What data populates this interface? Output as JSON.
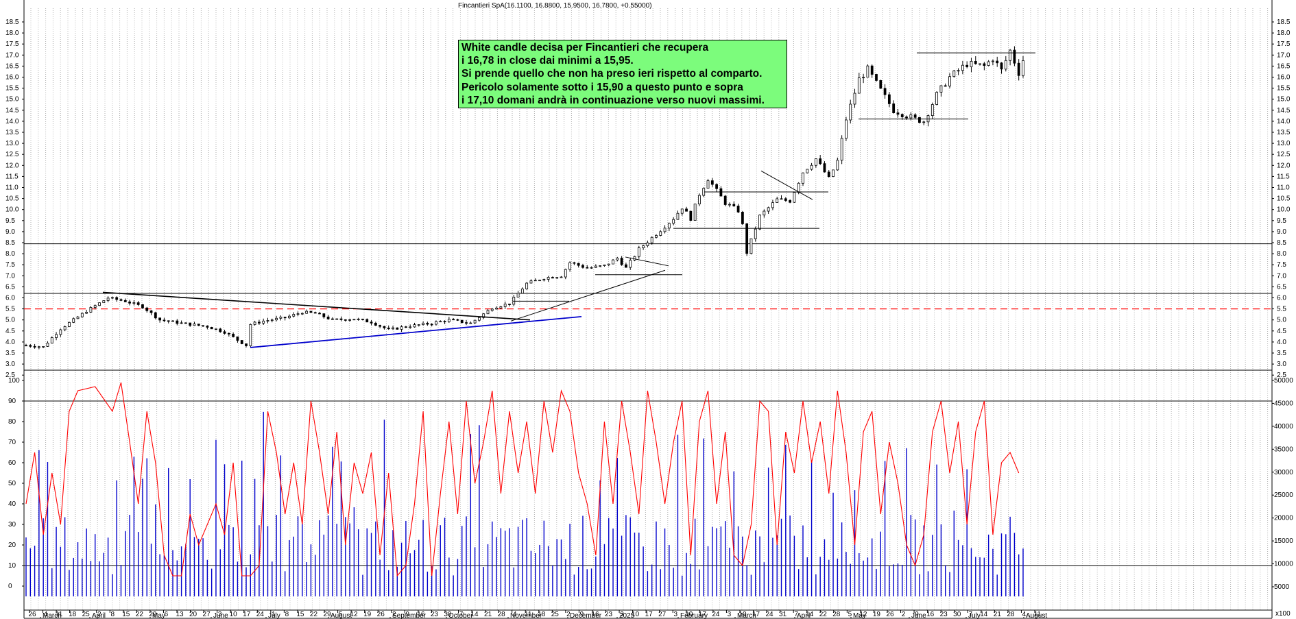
{
  "title": "Fincantieri SpA(16.1100, 16.8800, 15.9500, 16.7800, +0.55000)",
  "annotation": {
    "lines": [
      "White candle decisa per Fincantieri che recupera",
      "i 16,78 in close dai minimi a 15,95.",
      "Si prende quello che non ha preso ieri rispetto al comparto.",
      "Pericolo solamente sotto i 15,90 a questo punto e sopra",
      "i 17,10 domani andrà in continuazione verso nuovi massimi."
    ],
    "background": "#7CFC7C"
  },
  "chart_data": [
    {
      "type": "candlestick",
      "title": "Fincantieri SpA(16.1100, 16.8800, 15.9500, 16.7800, +0.55000)",
      "ylim": [
        2.0,
        18.5
      ],
      "y_ticks": [
        "2.5",
        "3.0",
        "3.5",
        "4.0",
        "4.5",
        "5.0",
        "5.5",
        "6.0",
        "6.5",
        "7.0",
        "7.5",
        "8.0",
        "8.5",
        "9.0",
        "9.5",
        "10.0",
        "10.5",
        "11.0",
        "11.5",
        "12.0",
        "12.5",
        "13.0",
        "13.5",
        "14.0",
        "14.5",
        "15.0",
        "15.5",
        "16.0",
        "16.5",
        "17.0",
        "17.5",
        "18.0",
        "18.5"
      ],
      "last": {
        "open": 16.11,
        "high": 16.88,
        "low": 15.95,
        "close": 16.78,
        "change": 0.55
      },
      "path_points": [
        [
          0,
          3.85
        ],
        [
          4,
          3.78
        ],
        [
          8,
          4.6
        ],
        [
          14,
          5.4
        ],
        [
          19,
          6.0
        ],
        [
          23,
          5.85
        ],
        [
          27,
          5.6
        ],
        [
          31,
          5.0
        ],
        [
          36,
          4.85
        ],
        [
          42,
          4.7
        ],
        [
          46,
          4.45
        ],
        [
          51,
          3.85
        ],
        [
          52,
          4.8
        ],
        [
          55,
          4.95
        ],
        [
          60,
          5.1
        ],
        [
          64,
          5.35
        ],
        [
          67,
          5.3
        ],
        [
          71,
          5.0
        ],
        [
          76,
          5.05
        ],
        [
          80,
          4.9
        ],
        [
          84,
          4.55
        ],
        [
          88,
          4.7
        ],
        [
          94,
          4.85
        ],
        [
          98,
          5.0
        ],
        [
          103,
          4.85
        ],
        [
          108,
          5.55
        ],
        [
          112,
          5.75
        ],
        [
          116,
          6.65
        ],
        [
          120,
          6.9
        ],
        [
          124,
          7.0
        ],
        [
          126,
          7.6
        ],
        [
          130,
          7.35
        ],
        [
          134,
          7.45
        ],
        [
          137,
          7.8
        ],
        [
          139,
          7.35
        ],
        [
          142,
          8.2
        ],
        [
          146,
          8.9
        ],
        [
          150,
          9.6
        ],
        [
          152,
          10.1
        ],
        [
          154,
          9.6
        ],
        [
          156,
          10.7
        ],
        [
          158,
          11.4
        ],
        [
          162,
          10.3
        ],
        [
          165,
          9.95
        ],
        [
          166,
          9.3
        ],
        [
          167,
          8.05
        ],
        [
          170,
          9.7
        ],
        [
          174,
          10.45
        ],
        [
          177,
          10.4
        ],
        [
          180,
          11.7
        ],
        [
          183,
          12.3
        ],
        [
          186,
          11.4
        ],
        [
          188,
          12.2
        ],
        [
          190,
          14.1
        ],
        [
          193,
          15.9
        ],
        [
          195,
          16.35
        ],
        [
          198,
          15.4
        ],
        [
          201,
          14.5
        ],
        [
          206,
          14.1
        ],
        [
          208,
          14.0
        ],
        [
          211,
          15.2
        ],
        [
          214,
          16.0
        ],
        [
          218,
          16.6
        ],
        [
          222,
          16.5
        ],
        [
          224,
          16.85
        ],
        [
          226,
          16.3
        ],
        [
          228,
          17.2
        ],
        [
          230,
          16.2
        ],
        [
          231,
          16.78
        ]
      ],
      "horizontal_levels": [
        8.45,
        6.2,
        5.5
      ]
    },
    {
      "type": "line+bar",
      "ylim": [
        -5,
        105
      ],
      "y_ticks": [
        "100",
        "90",
        "80",
        "70",
        "60",
        "50",
        "40",
        "30",
        "20",
        "10",
        "0"
      ],
      "levels": [
        90,
        10
      ],
      "volume_ticks": [
        "50000",
        "45000",
        "40000",
        "35000",
        "30000",
        "25000",
        "20000",
        "15000",
        "10000",
        "5000"
      ],
      "volume_unit": "x100",
      "oscillator_color": "#ff0000",
      "volume_color": "#0000cc",
      "oscillator_points": [
        [
          0,
          40
        ],
        [
          2,
          65
        ],
        [
          4,
          25
        ],
        [
          6,
          55
        ],
        [
          8,
          30
        ],
        [
          10,
          85
        ],
        [
          12,
          95
        ],
        [
          16,
          97
        ],
        [
          20,
          85
        ],
        [
          22,
          99
        ],
        [
          24,
          70
        ],
        [
          26,
          40
        ],
        [
          28,
          85
        ],
        [
          30,
          60
        ],
        [
          32,
          15
        ],
        [
          34,
          5
        ],
        [
          36,
          5
        ],
        [
          38,
          35
        ],
        [
          40,
          20
        ],
        [
          44,
          40
        ],
        [
          46,
          25
        ],
        [
          48,
          60
        ],
        [
          50,
          5
        ],
        [
          52,
          5
        ],
        [
          54,
          10
        ],
        [
          56,
          85
        ],
        [
          58,
          65
        ],
        [
          60,
          35
        ],
        [
          62,
          60
        ],
        [
          64,
          30
        ],
        [
          66,
          90
        ],
        [
          68,
          65
        ],
        [
          70,
          35
        ],
        [
          72,
          75
        ],
        [
          74,
          20
        ],
        [
          76,
          60
        ],
        [
          78,
          45
        ],
        [
          80,
          65
        ],
        [
          82,
          15
        ],
        [
          84,
          55
        ],
        [
          86,
          5
        ],
        [
          88,
          10
        ],
        [
          90,
          40
        ],
        [
          92,
          85
        ],
        [
          94,
          5
        ],
        [
          96,
          45
        ],
        [
          98,
          80
        ],
        [
          100,
          35
        ],
        [
          102,
          90
        ],
        [
          104,
          50
        ],
        [
          106,
          70
        ],
        [
          108,
          95
        ],
        [
          110,
          45
        ],
        [
          112,
          85
        ],
        [
          114,
          55
        ],
        [
          116,
          80
        ],
        [
          118,
          45
        ],
        [
          120,
          90
        ],
        [
          122,
          65
        ],
        [
          124,
          95
        ],
        [
          126,
          85
        ],
        [
          128,
          55
        ],
        [
          130,
          40
        ],
        [
          132,
          15
        ],
        [
          134,
          80
        ],
        [
          136,
          40
        ],
        [
          138,
          90
        ],
        [
          140,
          65
        ],
        [
          142,
          35
        ],
        [
          144,
          95
        ],
        [
          146,
          70
        ],
        [
          148,
          40
        ],
        [
          150,
          70
        ],
        [
          152,
          90
        ],
        [
          154,
          15
        ],
        [
          156,
          80
        ],
        [
          158,
          95
        ],
        [
          160,
          40
        ],
        [
          162,
          75
        ],
        [
          164,
          15
        ],
        [
          166,
          10
        ],
        [
          168,
          30
        ],
        [
          170,
          90
        ],
        [
          172,
          85
        ],
        [
          174,
          20
        ],
        [
          176,
          75
        ],
        [
          178,
          55
        ],
        [
          180,
          90
        ],
        [
          182,
          60
        ],
        [
          184,
          80
        ],
        [
          186,
          45
        ],
        [
          188,
          95
        ],
        [
          190,
          65
        ],
        [
          192,
          20
        ],
        [
          194,
          75
        ],
        [
          196,
          85
        ],
        [
          198,
          35
        ],
        [
          200,
          70
        ],
        [
          202,
          50
        ],
        [
          204,
          20
        ],
        [
          206,
          10
        ],
        [
          208,
          25
        ],
        [
          210,
          75
        ],
        [
          212,
          90
        ],
        [
          214,
          55
        ],
        [
          216,
          80
        ],
        [
          218,
          30
        ],
        [
          220,
          75
        ],
        [
          222,
          90
        ],
        [
          224,
          25
        ],
        [
          226,
          60
        ],
        [
          228,
          65
        ],
        [
          230,
          55
        ]
      ]
    }
  ],
  "x_axis": {
    "days": [
      "26",
      "4",
      "11",
      "18",
      "25",
      "2",
      "8",
      "15",
      "22",
      "29",
      "6",
      "13",
      "20",
      "27",
      "3",
      "10",
      "17",
      "24",
      "1",
      "8",
      "15",
      "22",
      "29",
      "5",
      "12",
      "19",
      "26",
      "2",
      "9",
      "16",
      "23",
      "30",
      "7",
      "14",
      "21",
      "28",
      "4",
      "11",
      "18",
      "25",
      "2",
      "9",
      "16",
      "23",
      "3",
      "10",
      "17",
      "27",
      "3",
      "10",
      "17",
      "24",
      "3",
      "10",
      "17",
      "24",
      "31",
      "7",
      "14",
      "22",
      "28",
      "5",
      "12",
      "19",
      "26",
      "2",
      "9",
      "16",
      "23",
      "30",
      "7",
      "14",
      "21",
      "28",
      "4",
      "11"
    ],
    "months": [
      "March",
      "April",
      "May",
      "June",
      "July",
      "August",
      "September",
      "October",
      "November",
      "December",
      "2025",
      "February",
      "March",
      "April",
      "May",
      "June",
      "July",
      "August"
    ]
  },
  "colors": {
    "red": "#ff0000",
    "blue": "#0000cc",
    "black": "#000000",
    "grid": "#b0b0b0"
  }
}
